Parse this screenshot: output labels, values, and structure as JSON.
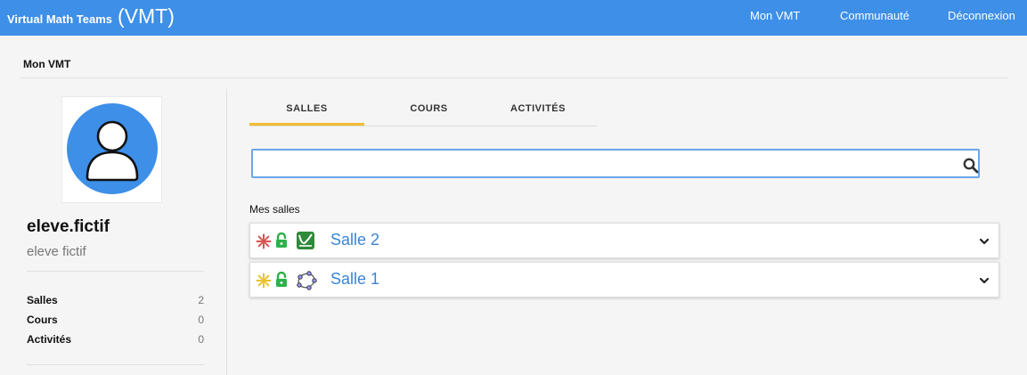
{
  "app": {
    "brand_small": "Virtual Math Teams",
    "brand_big": "(VMT)"
  },
  "nav": {
    "items": [
      "Mon VMT",
      "Communauté",
      "Déconnexion"
    ]
  },
  "breadcrumb": {
    "title": "Mon VMT"
  },
  "profile": {
    "username": "eleve.fictif",
    "fullname": "eleve fictif",
    "stats": [
      {
        "label": "Salles",
        "value": "2"
      },
      {
        "label": "Cours",
        "value": "0"
      },
      {
        "label": "Activités",
        "value": "0"
      }
    ]
  },
  "tabs": [
    {
      "label": "SALLES",
      "active": true
    },
    {
      "label": "COURS",
      "active": false
    },
    {
      "label": "ACTIVITÉS",
      "active": false
    }
  ],
  "search": {
    "value": "",
    "placeholder": ""
  },
  "rooms_section": {
    "title": "Mes salles"
  },
  "rooms": [
    {
      "name": "Salle 2",
      "role_icon": "role-facilitator-icon",
      "lock_icon": "unlocked-icon",
      "type_icon": "desmos-icon"
    },
    {
      "name": "Salle 1",
      "role_icon": "role-participant-icon",
      "lock_icon": "unlocked-icon",
      "type_icon": "geogebra-icon"
    }
  ],
  "colors": {
    "header": "#3d8fe8",
    "tab_underline": "#f2bc33",
    "link": "#3a84d6",
    "lock": "#2fb04a",
    "avatar": "#3d8fe8"
  }
}
